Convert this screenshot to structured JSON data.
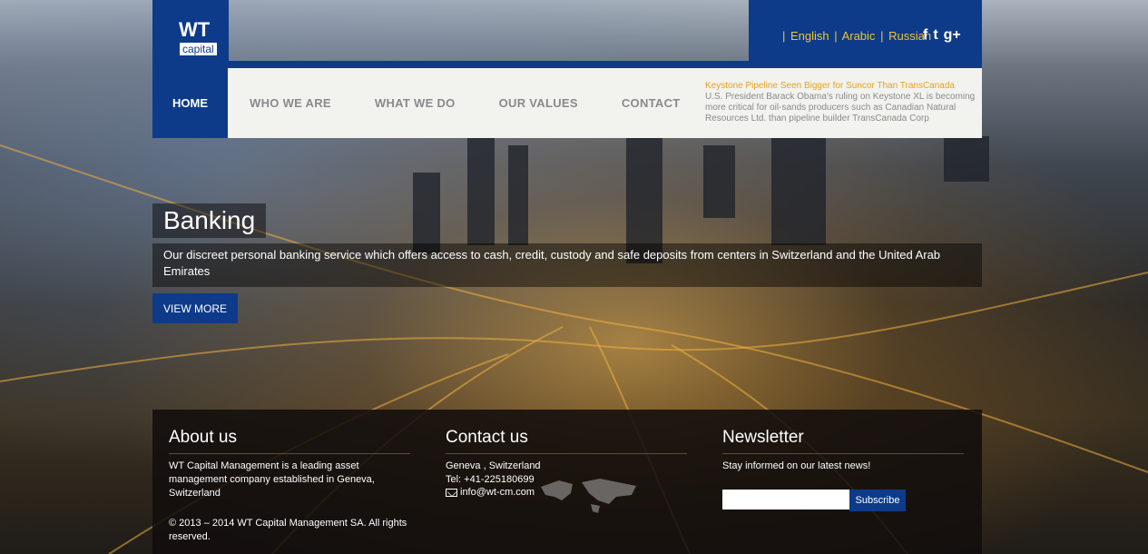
{
  "logo": {
    "line1": "WT",
    "line2": "capital"
  },
  "languages": [
    "English",
    "Arabic",
    "Russian"
  ],
  "social": [
    "f",
    "t",
    "g+"
  ],
  "nav": {
    "home": "HOME",
    "items": [
      "WHO WE ARE",
      "WHAT WE DO",
      "OUR VALUES",
      "CONTACT"
    ]
  },
  "news": {
    "title": "Keystone Pipeline Seen Bigger for Suncor Than TransCanada",
    "body": "U.S. President Barack Obama's ruling on Keystone XL is becoming more critical for oil-sands producers such as Canadian Natural Resources Ltd. than pipeline builder TransCanada Corp"
  },
  "banner": {
    "title": "Banking",
    "description": "Our discreet personal banking service which offers access to cash, credit, custody and safe deposits from centers in Switzerland and the United Arab Emirates",
    "button": "VIEW MORE"
  },
  "footer": {
    "about": {
      "heading": "About us",
      "text": "WT Capital Management is a leading asset management company established in Geneva, Switzerland",
      "copyright": "© 2013 – 2014 WT Capital Management SA. All rights reserved."
    },
    "contact": {
      "heading": "Contact us",
      "address": "Geneva , Switzerland",
      "phone": "Tel: +41-225180699",
      "email": "info@wt-cm.com"
    },
    "newsletter": {
      "heading": "Newsletter",
      "text": "Stay informed on our latest news!",
      "input_value": "",
      "button": "Subscribe"
    }
  },
  "colors": {
    "brand": "#0d3b8a",
    "accent": "#f1c232",
    "news_title": "#e8a317"
  }
}
